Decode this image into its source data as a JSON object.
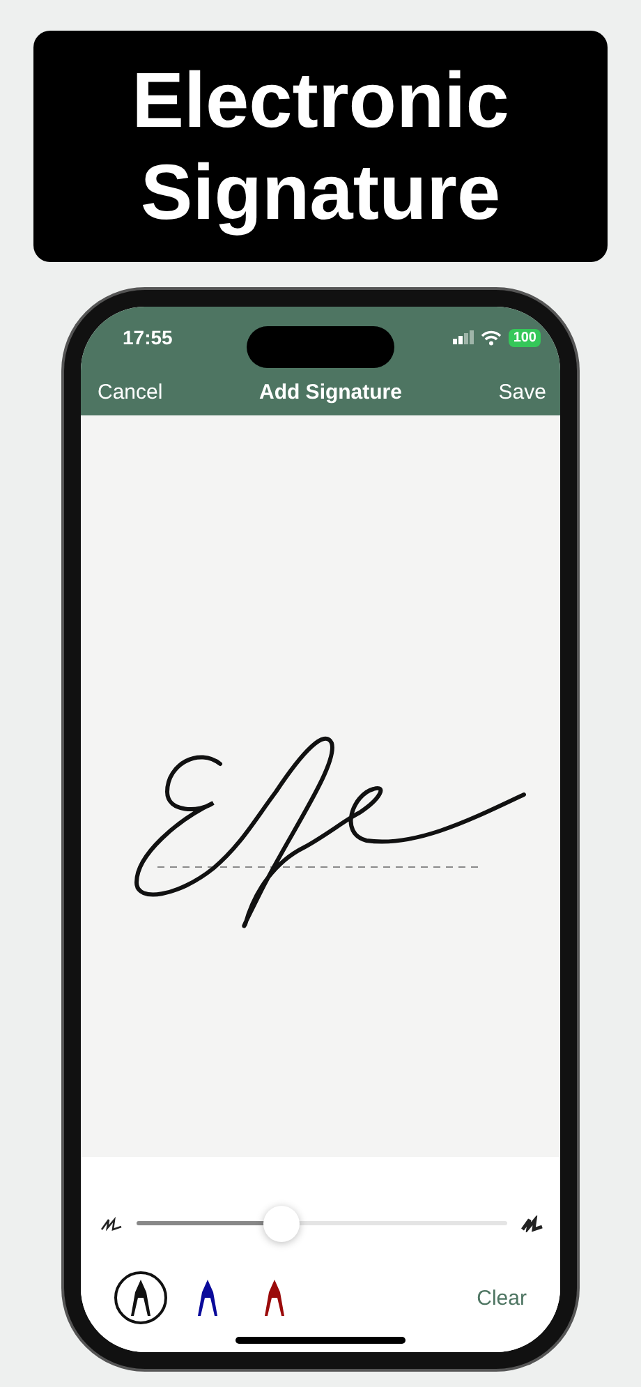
{
  "banner": {
    "lines": [
      "Electronic",
      "Signature"
    ]
  },
  "status_bar": {
    "time": "17:55",
    "battery": "100"
  },
  "nav": {
    "cancel": "Cancel",
    "title": "Add Signature",
    "save": "Save"
  },
  "slider": {
    "level": 0.39
  },
  "pens": [
    {
      "color": "#111111",
      "selected": true
    },
    {
      "color": "#0a0a9a",
      "selected": false
    },
    {
      "color": "#9a0a0a",
      "selected": false
    }
  ],
  "clear": "Clear"
}
